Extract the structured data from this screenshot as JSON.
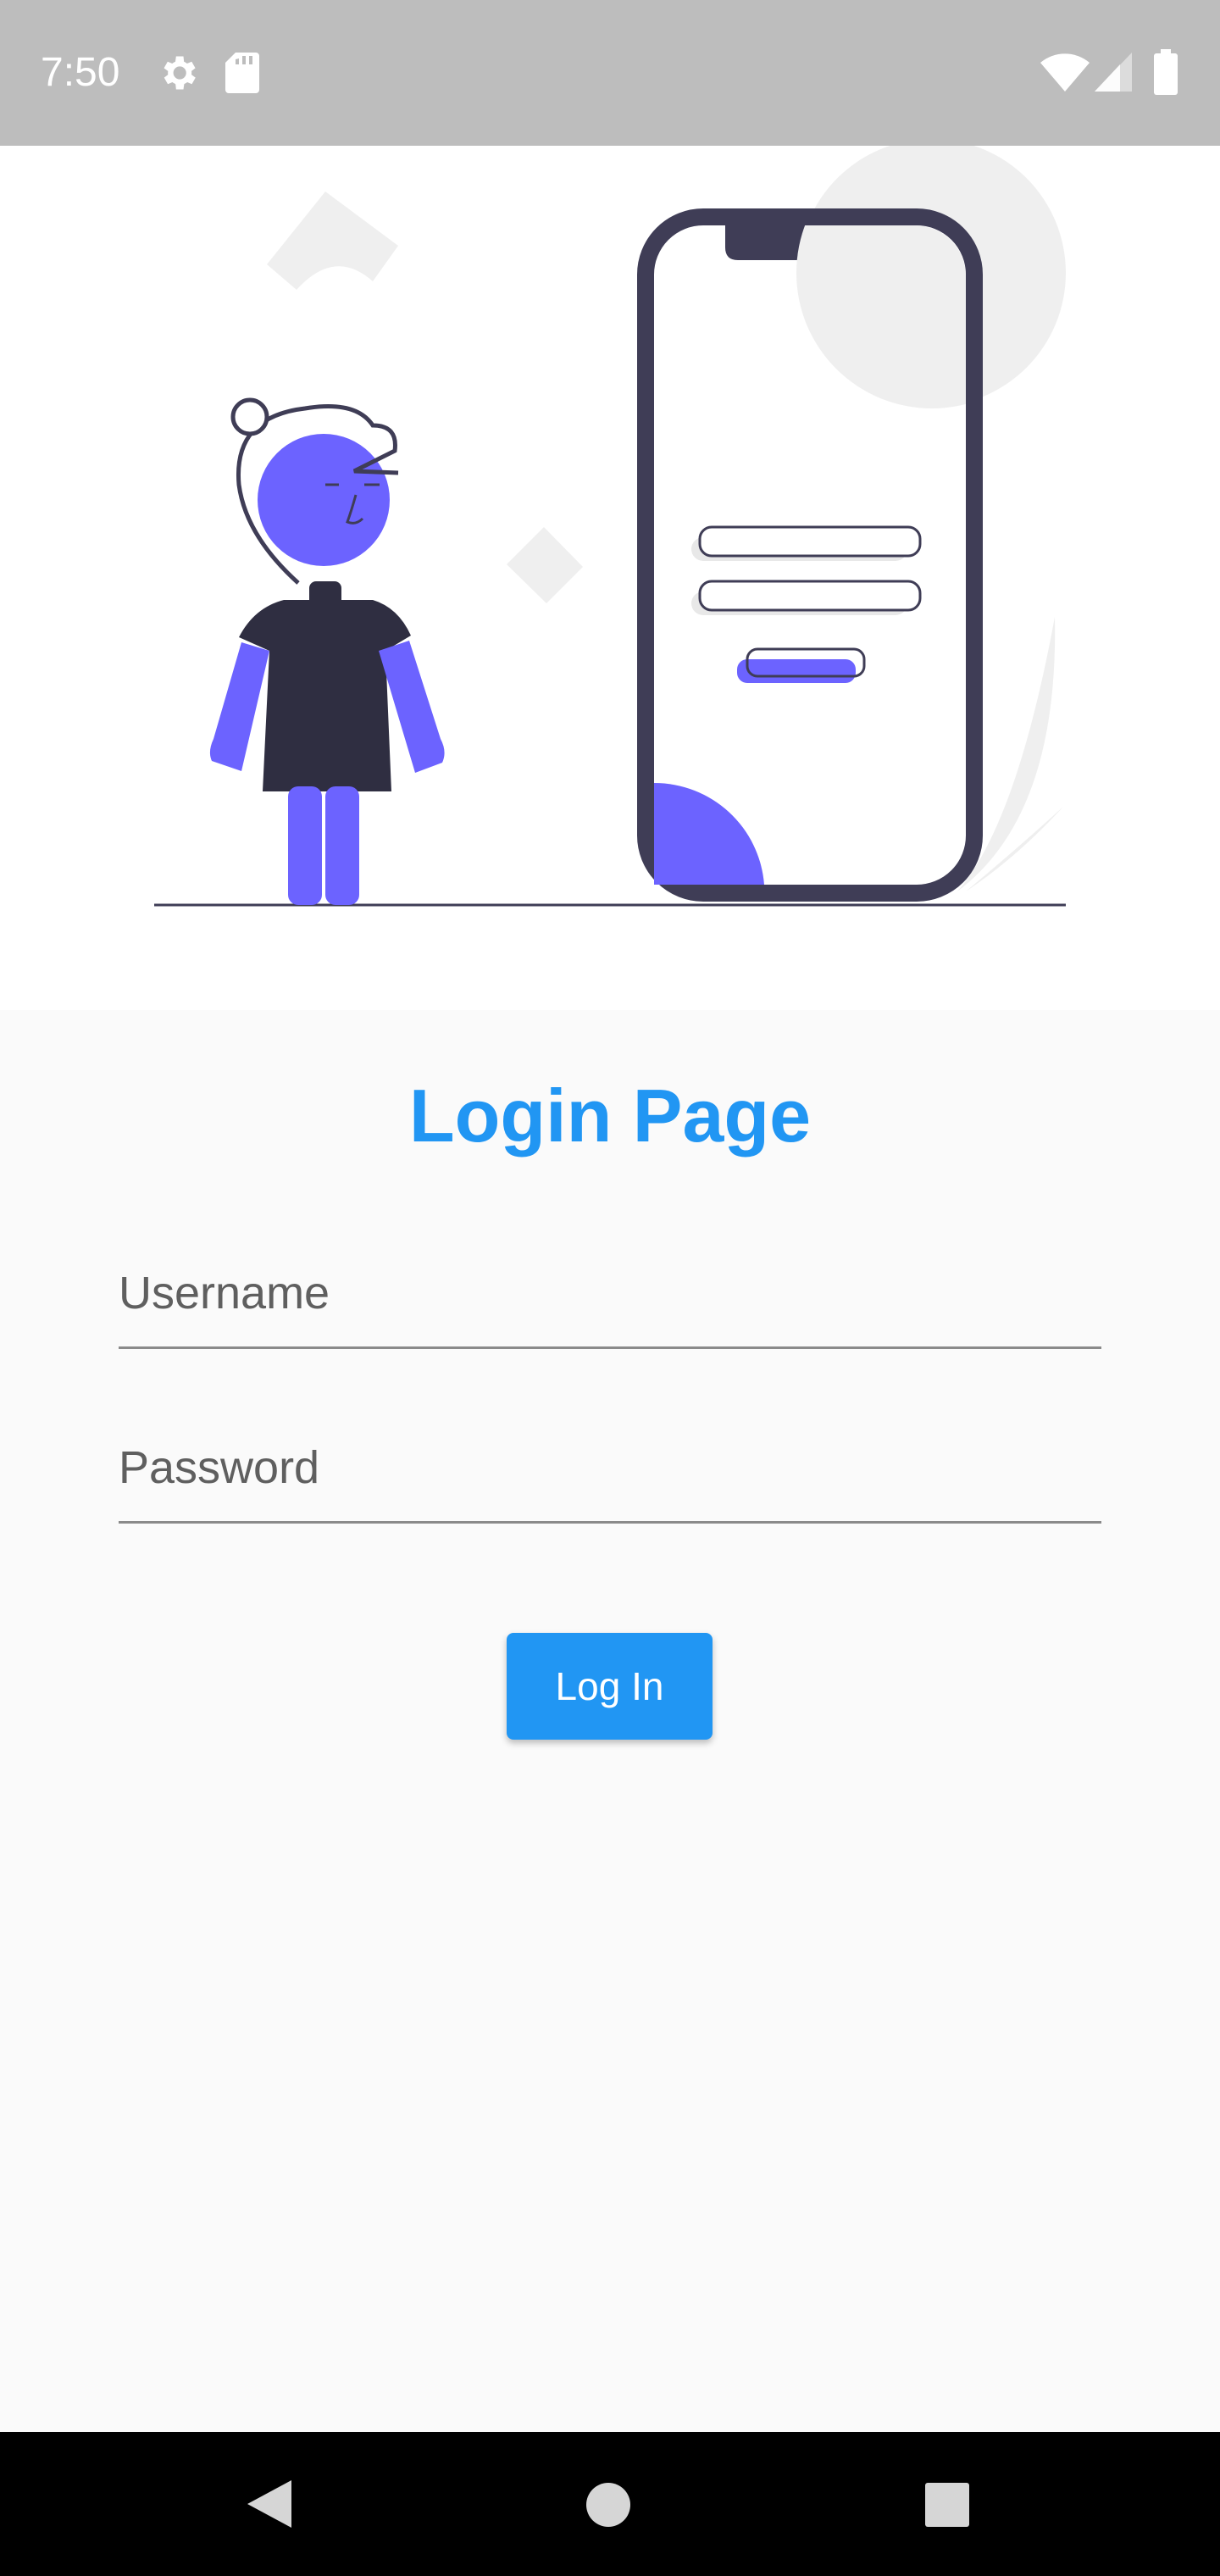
{
  "status_bar": {
    "time": "7:50",
    "icons_left": [
      "gear-icon",
      "sd-card-icon"
    ],
    "icons_right": [
      "wifi-icon",
      "signal-icon",
      "battery-icon"
    ],
    "background": "#bdbdbd"
  },
  "illustration": {
    "description_icon": "person-with-phone-login-illustration",
    "accent_color": "#6c63ff",
    "dark_color": "#3f3d56"
  },
  "login": {
    "title": "Login Page",
    "username_placeholder": "Username",
    "password_placeholder": "Password",
    "button_label": "Log In",
    "accent_color": "#2196f3"
  },
  "nav_bar": {
    "buttons": [
      "back-icon",
      "home-icon",
      "recents-icon"
    ]
  }
}
